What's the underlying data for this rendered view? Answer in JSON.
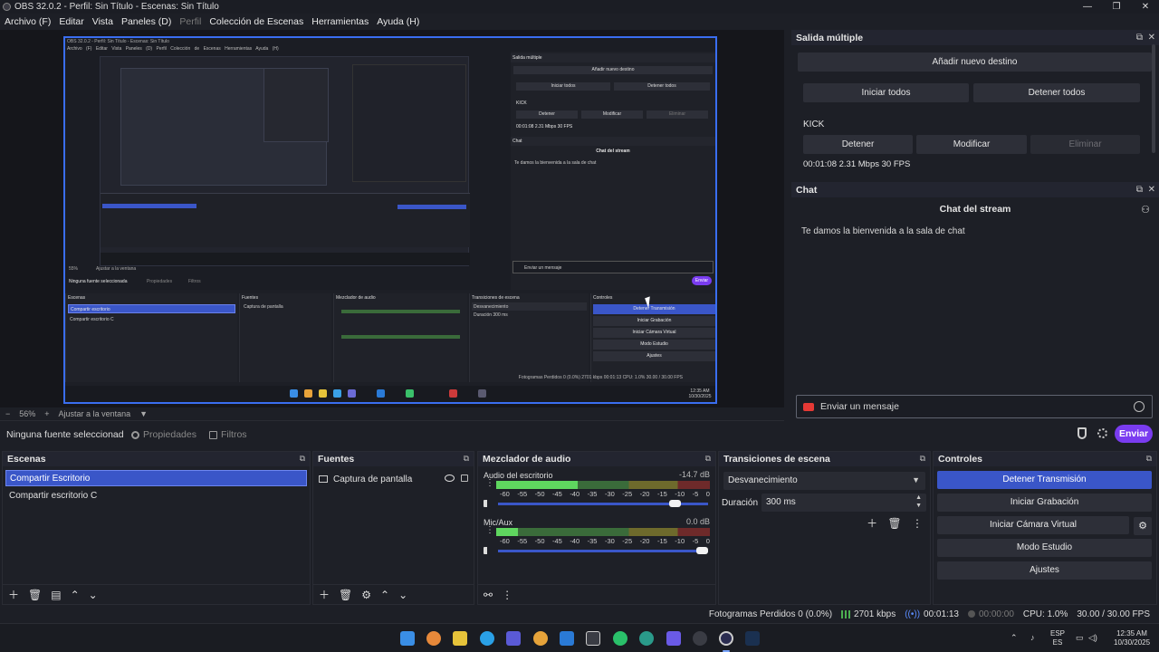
{
  "window": {
    "title": "OBS 32.0.2 - Perfil: Sin Título - Escenas: Sin Título"
  },
  "menu": [
    "Archivo (F)",
    "Editar",
    "Vista",
    "Paneles (D)",
    "Perfil",
    "Colección de Escenas",
    "Herramientas",
    "Ayuda (H)"
  ],
  "window_controls": {
    "minimize": "—",
    "maximize": "❐",
    "close": "✕"
  },
  "nested": {
    "title": "OBS 32.0.2 - Perfil: Sin Título - Escenas: Sin Título",
    "menu": "Archivo (F) Editar Vista Paneles (D) Perfil Colección de Escenas Herramientas Ayuda (H)",
    "multi_head": "Salida múltiple",
    "add_dest": "Añadir nuevo destino",
    "start_all": "Iniciar todos",
    "stop_all": "Detener todos",
    "kick": "KICK",
    "stop": "Detener",
    "modify": "Modificar",
    "delete": "Eliminar",
    "stats": "00:01:08 2.31 Mbps 30 FPS",
    "chat_head": "Chat",
    "chat_title": "Chat del stream",
    "chat_welcome": "Te damos la bienvenida a la sala de chat",
    "chat_input": "Enviar un mensaje",
    "send": "Enviar",
    "zoom": "55%",
    "fit": "Ajustar a la ventana",
    "no_source": "Ninguna fuente seleccionada",
    "props": "Propiedades",
    "filters": "Filtros",
    "scenes_head": "Escenas",
    "scene1": "Compartir escritorio",
    "scene2": "Compartir escritorio C",
    "sources_head": "Fuentes",
    "source1": "Captura de pantalla",
    "mixer_head": "Mezclador de audio",
    "trans_head": "Transiciones de escena",
    "trans_val": "Desvanecimiento",
    "dur_label": "Duración",
    "dur_val": "300 ms",
    "ctrl_head": "Controles",
    "ctrl": [
      "Detener Transmisión",
      "Iniciar Grabación",
      "Iniciar Cámara Virtual",
      "Modo Estudio",
      "Ajustes"
    ],
    "status": "Fotogramas Perdidos 0 (0.0%)   2701 kbps   00:01:13   CPU: 1.0%   30.00 / 30.00 FPS",
    "clock": "12:35 AM 10/30/2025"
  },
  "zoom": {
    "percent": "56%",
    "minus": "−",
    "plus": "+",
    "fit_label": "Ajustar a la ventana",
    "dropdown": "▼"
  },
  "context": {
    "no_source": "Ninguna fuente seleccionad",
    "properties": "Propiedades",
    "filters": "Filtros"
  },
  "multi_output": {
    "header": "Salida múltiple",
    "add_destination": "Añadir nuevo destino",
    "start_all": "Iniciar todos",
    "stop_all": "Detener todos",
    "platform": "KICK",
    "stop": "Detener",
    "modify": "Modificar",
    "delete": "Eliminar",
    "stats": "00:01:08  2.31 Mbps  30 FPS"
  },
  "chat": {
    "header": "Chat",
    "title": "Chat del stream",
    "welcome": "Te damos la bienvenida a la sala de chat",
    "placeholder": "Enviar un mensaje",
    "send": "Enviar"
  },
  "docks": {
    "scenes": {
      "header": "Escenas",
      "items": [
        "Compartir Escritorio",
        "Compartir escritorio C"
      ]
    },
    "sources": {
      "header": "Fuentes",
      "items": [
        "Captura de pantalla"
      ]
    },
    "mixer": {
      "header": "Mezclador de audio",
      "channels": [
        {
          "name": "Audio del escritorio",
          "db": "-14.7 dB",
          "level": 0.38,
          "volume": 0.87
        },
        {
          "name": "Mic/Aux",
          "db": "0.0 dB",
          "level": 0.1,
          "volume": 1.0
        }
      ],
      "ticks": [
        "-60",
        "-55",
        "-50",
        "-45",
        "-40",
        "-35",
        "-30",
        "-25",
        "-20",
        "-15",
        "-10",
        "-5",
        "0"
      ]
    },
    "transitions": {
      "header": "Transiciones de escena",
      "selected": "Desvanecimiento",
      "duration_label": "Duración",
      "duration_value": "300 ms"
    },
    "controls": {
      "header": "Controles",
      "stop_stream": "Detener Transmisión",
      "start_recording": "Iniciar Grabación",
      "start_virtual_cam": "Iniciar Cámara Virtual",
      "studio_mode": "Modo Estudio",
      "settings": "Ajustes"
    }
  },
  "status": {
    "dropped": "Fotogramas Perdidos 0 (0.0%)",
    "bitrate": "2701 kbps",
    "stream_time": "00:01:13",
    "rec_time": "00:00:00",
    "cpu": "CPU: 1.0%",
    "fps": "30.00 / 30.00 FPS"
  },
  "taskbar": {
    "lang1": "ESP",
    "lang2": "ES",
    "time": "12:35 AM",
    "date": "10/30/2025"
  },
  "colors": {
    "accent": "#3a56c8",
    "send": "#7a3cf0",
    "bg": "#1d1f26",
    "meter_green": "#5fd65f"
  }
}
